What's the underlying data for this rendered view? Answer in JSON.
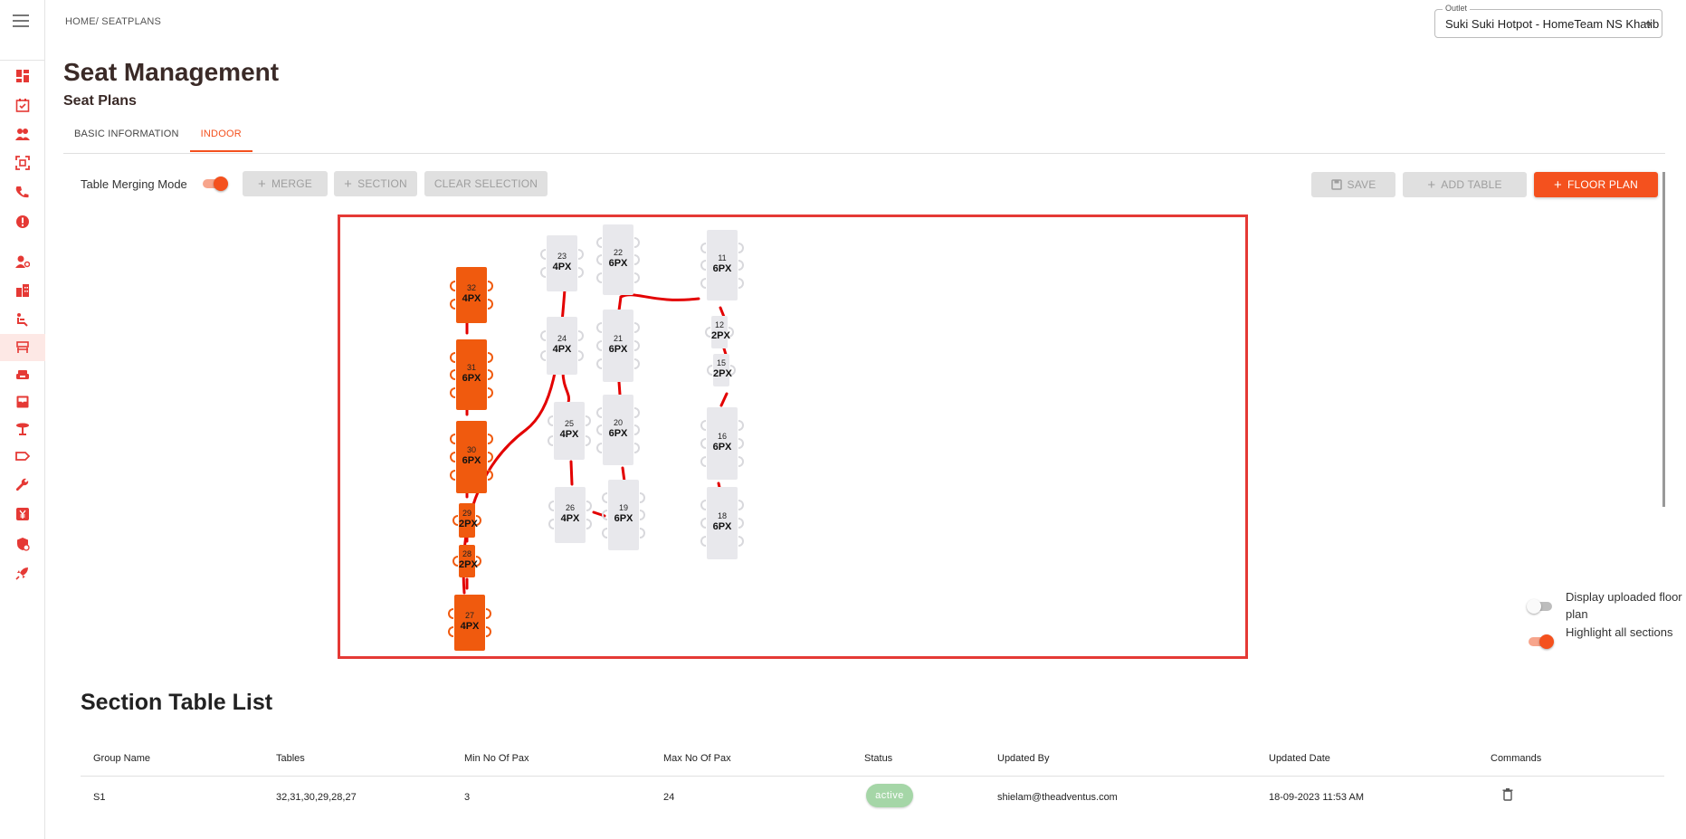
{
  "breadcrumb": "HOME/ SEATPLANS",
  "outlet": {
    "label": "Outlet",
    "value": "Suki Suki Hotpot - HomeTeam NS Khatib"
  },
  "page": {
    "title": "Seat Management",
    "subtitle": "Seat Plans"
  },
  "tabs": [
    {
      "label": "BASIC INFORMATION",
      "active": false
    },
    {
      "label": "INDOOR",
      "active": true
    }
  ],
  "toolbar": {
    "merge_mode_label": "Table Merging Mode",
    "merge_mode_on": true,
    "merge": "MERGE",
    "section": "SECTION",
    "clear_selection": "CLEAR SELECTION",
    "save": "SAVE",
    "add_table": "ADD TABLE",
    "floor_plan": "FLOOR PLAN"
  },
  "sidebar_icons": [
    "dashboard-icon",
    "calendar-check-icon",
    "customers-icon",
    "scan-icon",
    "phone-icon",
    "alert-icon",
    "user-settings-icon",
    "building-icon",
    "seat-icon",
    "table-icon",
    "sofa-icon",
    "inbox-icon",
    "round-table-icon",
    "tag-icon",
    "wrench-icon",
    "currency-icon",
    "security-icon",
    "rocket-icon"
  ],
  "tables": [
    {
      "id": "t32",
      "number": "32",
      "pax": "4PX",
      "selected": true
    },
    {
      "id": "t31",
      "number": "31",
      "pax": "6PX",
      "selected": true
    },
    {
      "id": "t30",
      "number": "30",
      "pax": "6PX",
      "selected": true
    },
    {
      "id": "t29",
      "number": "29",
      "pax": "2PX",
      "selected": true
    },
    {
      "id": "t28",
      "number": "28",
      "pax": "2PX",
      "selected": true
    },
    {
      "id": "t27",
      "number": "27",
      "pax": "4PX",
      "selected": true
    },
    {
      "id": "t23",
      "number": "23",
      "pax": "4PX",
      "selected": false
    },
    {
      "id": "t24",
      "number": "24",
      "pax": "4PX",
      "selected": false
    },
    {
      "id": "t25",
      "number": "25",
      "pax": "4PX",
      "selected": false
    },
    {
      "id": "t26",
      "number": "26",
      "pax": "4PX",
      "selected": false
    },
    {
      "id": "t22",
      "number": "22",
      "pax": "6PX",
      "selected": false
    },
    {
      "id": "t21",
      "number": "21",
      "pax": "6PX",
      "selected": false
    },
    {
      "id": "t20",
      "number": "20",
      "pax": "6PX",
      "selected": false
    },
    {
      "id": "t19",
      "number": "19",
      "pax": "6PX",
      "selected": false
    },
    {
      "id": "t11",
      "number": "11",
      "pax": "6PX",
      "selected": false
    },
    {
      "id": "t12",
      "number": "12",
      "pax": "2PX",
      "selected": false
    },
    {
      "id": "t15",
      "number": "15",
      "pax": "2PX",
      "selected": false
    },
    {
      "id": "t16",
      "number": "16",
      "pax": "6PX",
      "selected": false
    },
    {
      "id": "t18",
      "number": "18",
      "pax": "6PX",
      "selected": false
    }
  ],
  "floor_toggles": {
    "display_uploaded": {
      "label": "Display uploaded floor plan",
      "on": false
    },
    "highlight_sections": {
      "label": "Highlight all sections",
      "on": true
    }
  },
  "section_list": {
    "title": "Section Table List",
    "columns": [
      "Group Name",
      "Tables",
      "Min No Of Pax",
      "Max No Of Pax",
      "Status",
      "Updated By",
      "Updated Date",
      "Commands"
    ],
    "rows": [
      {
        "group_name": "S1",
        "tables": "32,31,30,29,28,27",
        "min_pax": "3",
        "max_pax": "24",
        "status": "active",
        "updated_by": "shielam@theadventus.com",
        "updated_date": "18-09-2023 11:53 AM"
      }
    ]
  },
  "colors": {
    "accent": "#f4511e",
    "selected_table": "#f05a0e",
    "link_line": "#e30000",
    "canvas_border": "#e53935",
    "status_active": "#a5d6a7"
  }
}
